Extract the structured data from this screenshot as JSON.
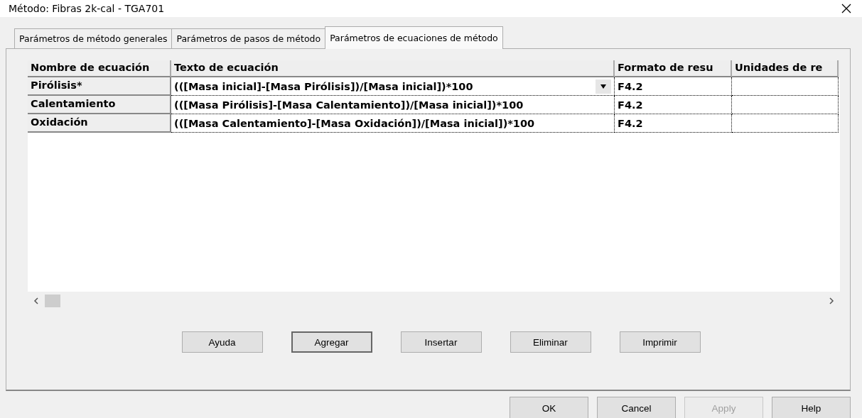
{
  "window": {
    "title": "Método: Fibras 2k-cal - TGA701"
  },
  "tabs": [
    {
      "label": "Parámetros de método generales",
      "selected": false
    },
    {
      "label": "Parámetros de pasos de método",
      "selected": false
    },
    {
      "label": "Parámetros de ecuaciones de método",
      "selected": true
    }
  ],
  "table": {
    "columns": [
      "Nombre de ecuación",
      "Texto de ecuación",
      "Formato de resu",
      "Unidades de re"
    ],
    "rows": [
      {
        "name": "Pirólisis*",
        "equation": "(([Masa inicial]-[Masa Pirólisis])/[Masa inicial])*100",
        "format": "F4.2",
        "selected": true
      },
      {
        "name": "Calentamiento",
        "equation": "(([Masa Pirólisis]-[Masa Calentamiento])/[Masa inicial])*100",
        "format": "F4.2",
        "selected": false
      },
      {
        "name": "Oxidación",
        "equation": "(([Masa Calentamiento]-[Masa Oxidación])/[Masa inicial])*100",
        "format": "F4.2",
        "selected": false
      }
    ]
  },
  "panel_buttons": [
    {
      "label": "Ayuda",
      "default": false
    },
    {
      "label": "Agregar",
      "default": true
    },
    {
      "label": "Insertar",
      "default": false
    },
    {
      "label": "Eliminar",
      "default": false
    },
    {
      "label": "Imprimir",
      "default": false
    }
  ],
  "dialog_buttons": [
    {
      "label": "OK",
      "disabled": false
    },
    {
      "label": "Cancel",
      "disabled": false
    },
    {
      "label": "Apply",
      "disabled": true
    },
    {
      "label": "Help",
      "disabled": false
    }
  ]
}
